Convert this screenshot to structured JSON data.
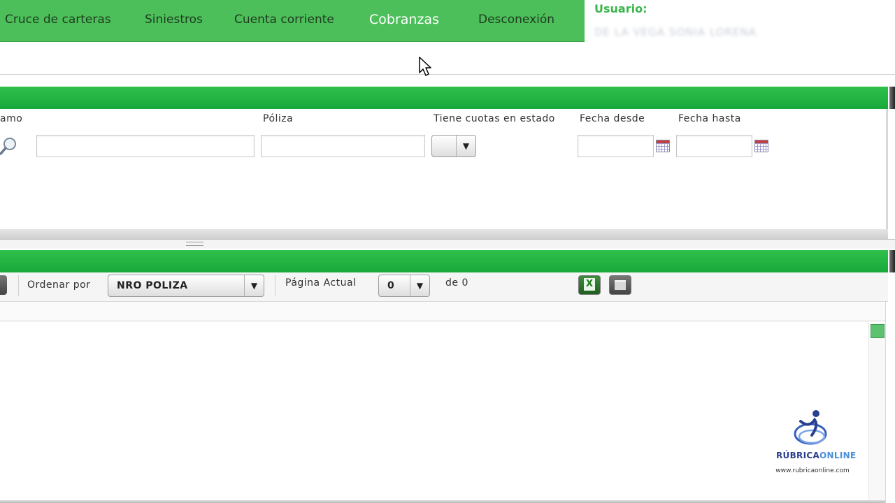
{
  "nav": {
    "items": [
      {
        "label": "Cruce de carteras"
      },
      {
        "label": "Siniestros"
      },
      {
        "label": "Cuenta corriente"
      },
      {
        "label": "Cobranzas"
      },
      {
        "label": "Desconexión"
      }
    ],
    "active": "Cobranzas"
  },
  "user": {
    "label": "Usuario:",
    "name": "DE LA VEGA SONIA LORENA"
  },
  "filters": {
    "ramo_label": "amo",
    "poliza_label": "Póliza",
    "cuotas_label": "Tiene cuotas en estado",
    "fecha_desde_label": "Fecha desde",
    "fecha_hasta_label": "Fecha hasta",
    "ramo_value": "",
    "poliza_value": "",
    "fecha_desde_value": "",
    "fecha_hasta_value": ""
  },
  "toolbar": {
    "ordenar_label": "Ordenar por",
    "ordenar_value": "NRO POLIZA",
    "pagina_label": "Página Actual",
    "pagina_value": "0",
    "de_label": "de 0",
    "excel_glyph": "X"
  },
  "branding": {
    "logo_word1": "RÚBRICA",
    "logo_word2": "ONLINE",
    "url": "www.rubricaonline.com"
  },
  "colors": {
    "nav_green": "#4cbf5a",
    "bar_green": "#17a83a",
    "user_label": "#3cb64b"
  }
}
